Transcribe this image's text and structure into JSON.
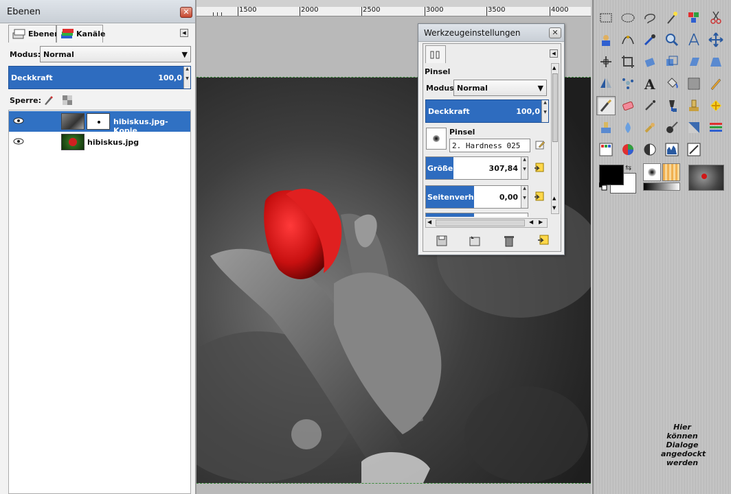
{
  "ruler": {
    "labels": [
      "1500",
      "2000",
      "2500",
      "3000",
      "3500",
      "4000"
    ]
  },
  "layers_dock": {
    "title": "Ebenen",
    "tabs": [
      {
        "label": "Ebenen"
      },
      {
        "label": "Kanäle"
      }
    ],
    "mode_label": "Modus:",
    "mode_value": "Normal",
    "opacity_label": "Deckkraft",
    "opacity_value": "100,0",
    "lock_label": "Sperre:",
    "layers": [
      {
        "name": "hibiskus.jpg-Kopie",
        "selected": true,
        "visible": true
      },
      {
        "name": "hibiskus.jpg",
        "selected": false,
        "visible": true
      }
    ]
  },
  "tool_options": {
    "title": "Werkzeugeinstellungen",
    "tool_name": "Pinsel",
    "mode_label": "Modus:",
    "mode_value": "Normal",
    "opacity_label": "Deckkraft",
    "opacity_value": "100,0",
    "brush_label": "Pinsel",
    "brush_value": "2. Hardness 025",
    "size_label": "Größe",
    "size_value": "307,84",
    "aspect_label": "Seitenverhältnis",
    "aspect_value": "0,00"
  },
  "toolbox": {
    "dock_hint_lines": [
      "Hier",
      "können",
      "Dialoge",
      "angedockt",
      "werden"
    ],
    "tools": [
      "rect-select-icon",
      "ellipse-select-icon",
      "lasso-icon",
      "fuzzy-select-icon",
      "color-select-icon",
      "scissors-icon",
      "foreground-select-icon",
      "paths-icon",
      "color-picker-icon",
      "zoom-icon",
      "measure-icon",
      "move-icon",
      "align-icon",
      "crop-icon",
      "rotate-icon",
      "scale-icon",
      "shear-icon",
      "perspective-icon",
      "flip-icon",
      "cage-icon",
      "text-icon",
      "bucket-fill-icon",
      "blend-icon",
      "pencil-icon",
      "paintbrush-icon",
      "eraser-icon",
      "airbrush-icon",
      "ink-icon",
      "clone-icon",
      "heal-icon",
      "perspective-clone-icon",
      "blur-icon",
      "smudge-icon",
      "dodge-burn-icon",
      "levels-icon",
      "curves-icon",
      "color-balance-icon",
      "hue-saturation-icon",
      "threshold-icon",
      "histogram-icon",
      "desaturate-icon"
    ]
  },
  "colors": {
    "selection_blue": "#3071c3",
    "flower_red": "#d81818",
    "close_red": "#c5472f"
  }
}
